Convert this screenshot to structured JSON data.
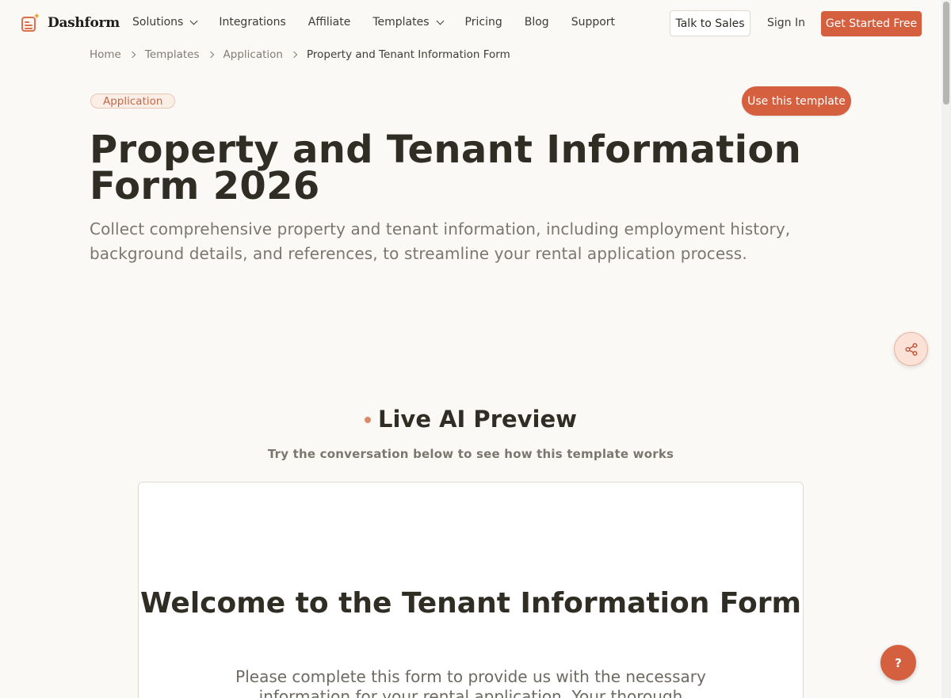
{
  "header": {
    "brand": "Dashform",
    "nav": [
      {
        "label": "Solutions",
        "has_dropdown": true
      },
      {
        "label": "Integrations",
        "has_dropdown": false
      },
      {
        "label": "Affiliate",
        "has_dropdown": false
      },
      {
        "label": "Templates",
        "has_dropdown": true
      },
      {
        "label": "Pricing",
        "has_dropdown": false
      },
      {
        "label": "Blog",
        "has_dropdown": false
      },
      {
        "label": "Support",
        "has_dropdown": false
      }
    ],
    "talk_to_sales": "Talk to Sales",
    "sign_in": "Sign In",
    "get_started": "Get Started Free"
  },
  "breadcrumb": [
    "Home",
    "Templates",
    "Application",
    "Property and Tenant Information Form"
  ],
  "hero": {
    "badge": "Application",
    "use_template": "Use this template",
    "title": "Property and Tenant Information Form 2026",
    "description": "Collect comprehensive property and tenant information, including employment history, background details, and references, to streamline your rental application process."
  },
  "preview": {
    "title": "Live AI Preview",
    "subtitle": "Try the conversation below to see how this template works",
    "card_title": "Welcome to the Tenant Information Form",
    "card_description": "Please complete this form to provide us with the necessary information for your rental application. Your thorough responses"
  },
  "help_label": "?",
  "colors": {
    "accent": "#d4603f",
    "background": "#fbf9f6",
    "badge_bg": "#fbeee6",
    "text_dark": "#2f2d24",
    "text_muted": "#7b776f"
  },
  "icons": [
    "logo-icon",
    "chevron-down-icon",
    "chevron-right-icon",
    "share-icon",
    "help-icon"
  ]
}
